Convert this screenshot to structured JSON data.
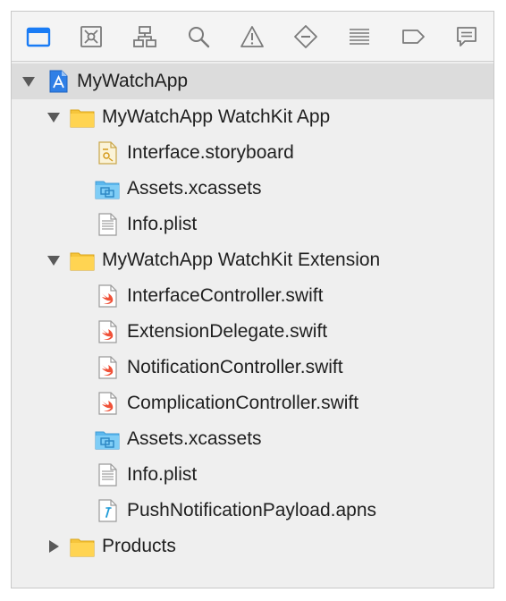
{
  "toolbar": {
    "icons": [
      "folder-icon",
      "source-control-icon",
      "hierarchy-icon",
      "search-icon",
      "warning-icon",
      "breakpoint-icon",
      "list-icon",
      "tag-icon",
      "comment-icon"
    ],
    "accent": "#1a7cf5"
  },
  "tree": {
    "root": "MyWatchApp",
    "group1": "MyWatchApp WatchKit App",
    "g1_storyboard": "Interface.storyboard",
    "g1_assets": "Assets.xcassets",
    "g1_plist": "Info.plist",
    "group2": "MyWatchApp WatchKit Extension",
    "g2_ic": "InterfaceController.swift",
    "g2_ed": "ExtensionDelegate.swift",
    "g2_nc": "NotificationController.swift",
    "g2_cc": "ComplicationController.swift",
    "g2_assets": "Assets.xcassets",
    "g2_plist": "Info.plist",
    "g2_apns": "PushNotificationPayload.apns",
    "products": "Products"
  }
}
